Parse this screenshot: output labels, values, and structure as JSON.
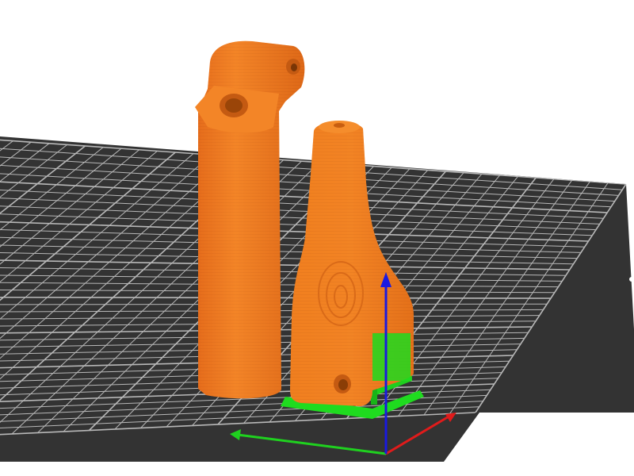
{
  "viewport": {
    "background_color": "#ffffff",
    "bed_color": "#333333",
    "grid_color": "#cfcfcf",
    "part_color": "#f07a1e",
    "part_shadow_color": "#c85e10",
    "support_color": "#1edb1e",
    "axis_colors": {
      "x": "#e01b1b",
      "y": "#1fd11f",
      "z": "#1a1ae0"
    }
  },
  "objects": [
    {
      "name": "tall-cylinder-arm-part",
      "icon": "3d-part"
    },
    {
      "name": "tapered-mount-part",
      "icon": "3d-part"
    }
  ]
}
